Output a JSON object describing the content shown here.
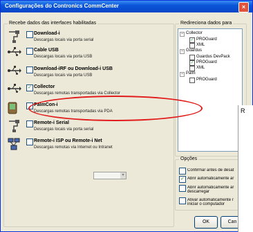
{
  "window": {
    "title": "Configurações do Contronics CommCenter",
    "close_glyph": "×"
  },
  "sources_group": {
    "legend": "Recebe dados das interfaces habilitadas",
    "items": [
      {
        "title": "Download-i",
        "desc": "Descargas locais via porta serial",
        "checked": false,
        "icon": "serial-cable-icon"
      },
      {
        "title": "Cable USB",
        "desc": "Descargas locais via porta USB",
        "checked": false,
        "icon": "usb-icon"
      },
      {
        "title": "Download-iRF ou Download-i USB",
        "desc": "Descargas locais via porta USB",
        "checked": false,
        "icon": "usb-icon"
      },
      {
        "title": "Collector",
        "desc": "Descargas remotas transportadas via Collector",
        "checked": true,
        "icon": "usb-icon"
      },
      {
        "title": "PalmCon-i",
        "desc": "Descargas remotas transportadas via PDA",
        "checked": false,
        "icon": "pda-icon"
      },
      {
        "title": "Remote-i Serial",
        "desc": "Descargas locais via porta serial",
        "checked": false,
        "icon": "serial-cable-icon"
      },
      {
        "title": "Remote-i ISP ou Remote-i Net",
        "desc": "Descargas remotas via Internet ou Intranet",
        "checked": false,
        "icon": "network-icon"
      }
    ],
    "select_arrow": "▾"
  },
  "redirect_group": {
    "legend": "Redireciona dados para",
    "tree": [
      {
        "label": "Collector",
        "level": 0,
        "expander": "−"
      },
      {
        "label": "PROGuard",
        "level": 1,
        "checked": true
      },
      {
        "label": "XML",
        "level": 1,
        "checked": false
      },
      {
        "label": "Guardus",
        "level": 0,
        "expander": "−"
      },
      {
        "label": "Guardus DevPack",
        "level": 1,
        "checked": false
      },
      {
        "label": "PROGuard",
        "level": 1,
        "checked": true
      },
      {
        "label": "XML",
        "level": 1,
        "checked": false
      },
      {
        "label": "Palm",
        "level": 0,
        "expander": "−"
      },
      {
        "label": "PROGuard",
        "level": 1,
        "checked": false
      }
    ]
  },
  "options_group": {
    "legend": "Opções",
    "items": [
      {
        "label": "Confirmar antes de desat",
        "checked": false
      },
      {
        "label": "Abrir automaticamente ar",
        "checked": true
      },
      {
        "label": "Abrir automaticamente ar descarregar",
        "checked": false
      },
      {
        "label": "Ativar automaticamente r iniciar o computador",
        "checked": false
      }
    ]
  },
  "overlap_panel": {
    "title": "R"
  },
  "buttons": {
    "ok": "OK",
    "cancel": "Can"
  },
  "colors": {
    "annotation_ellipse": "#e21b1b",
    "title_bar": "#0a55d8"
  }
}
